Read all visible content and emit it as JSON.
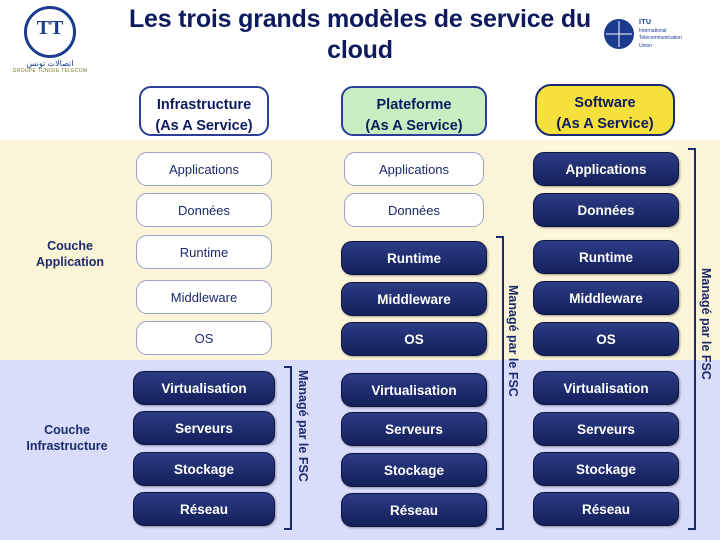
{
  "title": "Les trois grands modèles de service du cloud",
  "logos": {
    "left": {
      "name": "Tunisie Telecom",
      "mark": "TT",
      "arabic": "اتصالات تونس",
      "sub": "GROUPE TUNISIE TELECOM"
    },
    "right": {
      "name": "ITU",
      "line1": "International",
      "line2": "Telecommunication",
      "line3": "Union"
    }
  },
  "columns": [
    {
      "id": "iaas",
      "title": "Infrastructure",
      "subtitle": "(As A Service)",
      "rows": [
        "Applications",
        "Données",
        "Runtime",
        "Middleware",
        "OS",
        "Virtualisation",
        "Serveurs",
        "Stockage",
        "Réseau"
      ]
    },
    {
      "id": "paas",
      "title": "Plateforme",
      "subtitle": "(As A Service)",
      "rows": [
        "Applications",
        "Données",
        "Runtime",
        "Middleware",
        "OS",
        "Virtualisation",
        "Serveurs",
        "Stockage",
        "Réseau"
      ]
    },
    {
      "id": "saas",
      "title": "Software",
      "subtitle": "(As A Service)",
      "rows": [
        "Applications",
        "Données",
        "Runtime",
        "Middleware",
        "OS",
        "Virtualisation",
        "Serveurs",
        "Stockage",
        "Réseau"
      ]
    }
  ],
  "layers": [
    {
      "id": "application",
      "line1": "Couche",
      "line2": "Application"
    },
    {
      "id": "infrastructure",
      "line1": "Couche",
      "line2": "Infrastructure"
    }
  ],
  "managed_labels": {
    "iaas": "Managé par le FSC",
    "paas": "Managé par le FSC",
    "saas": "Managé par le FSC"
  },
  "colors": {
    "band_application": "#fdf5d8",
    "band_infrastructure": "#d9dcfa",
    "header_iaas": "#ffffff",
    "header_paas": "#c7edc0",
    "header_saas": "#f5e03c",
    "navy": "#1b2a6b",
    "title_color": "#0d1b5e"
  }
}
